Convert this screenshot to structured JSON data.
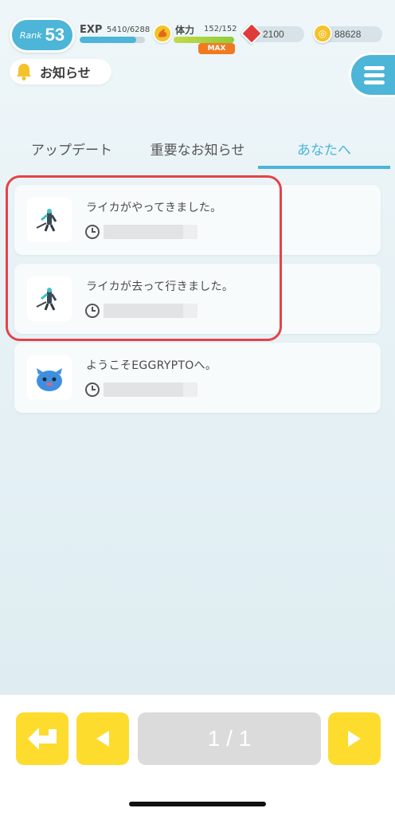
{
  "header": {
    "rank_label": "Rank",
    "rank_value": "53",
    "exp_label": "EXP",
    "exp_value": "5410/6288",
    "exp_progress": 0.86,
    "stamina_label": "体力",
    "stamina_value": "152/152",
    "stamina_progress": 1.0,
    "stamina_badge": "MAX",
    "gems": "2100",
    "coins": "88628",
    "notice_label": "お知らせ"
  },
  "tabs": [
    {
      "label": "アップデート",
      "active": false
    },
    {
      "label": "重要なお知らせ",
      "active": false
    },
    {
      "label": "あなたへ",
      "active": true
    }
  ],
  "notifications": [
    {
      "title": "ライカがやってきました。",
      "icon": "robot-character-icon"
    },
    {
      "title": "ライカが去って行きました。",
      "icon": "robot-character-icon"
    },
    {
      "title": "ようこそEGGRYPTOへ。",
      "icon": "blue-egg-monster-icon"
    }
  ],
  "pagination": {
    "label": "1 / 1"
  },
  "colors": {
    "accent": "#4cb5d8",
    "button": "#fddc2e",
    "highlight": "#e5424a",
    "max_badge": "#f07a22"
  }
}
